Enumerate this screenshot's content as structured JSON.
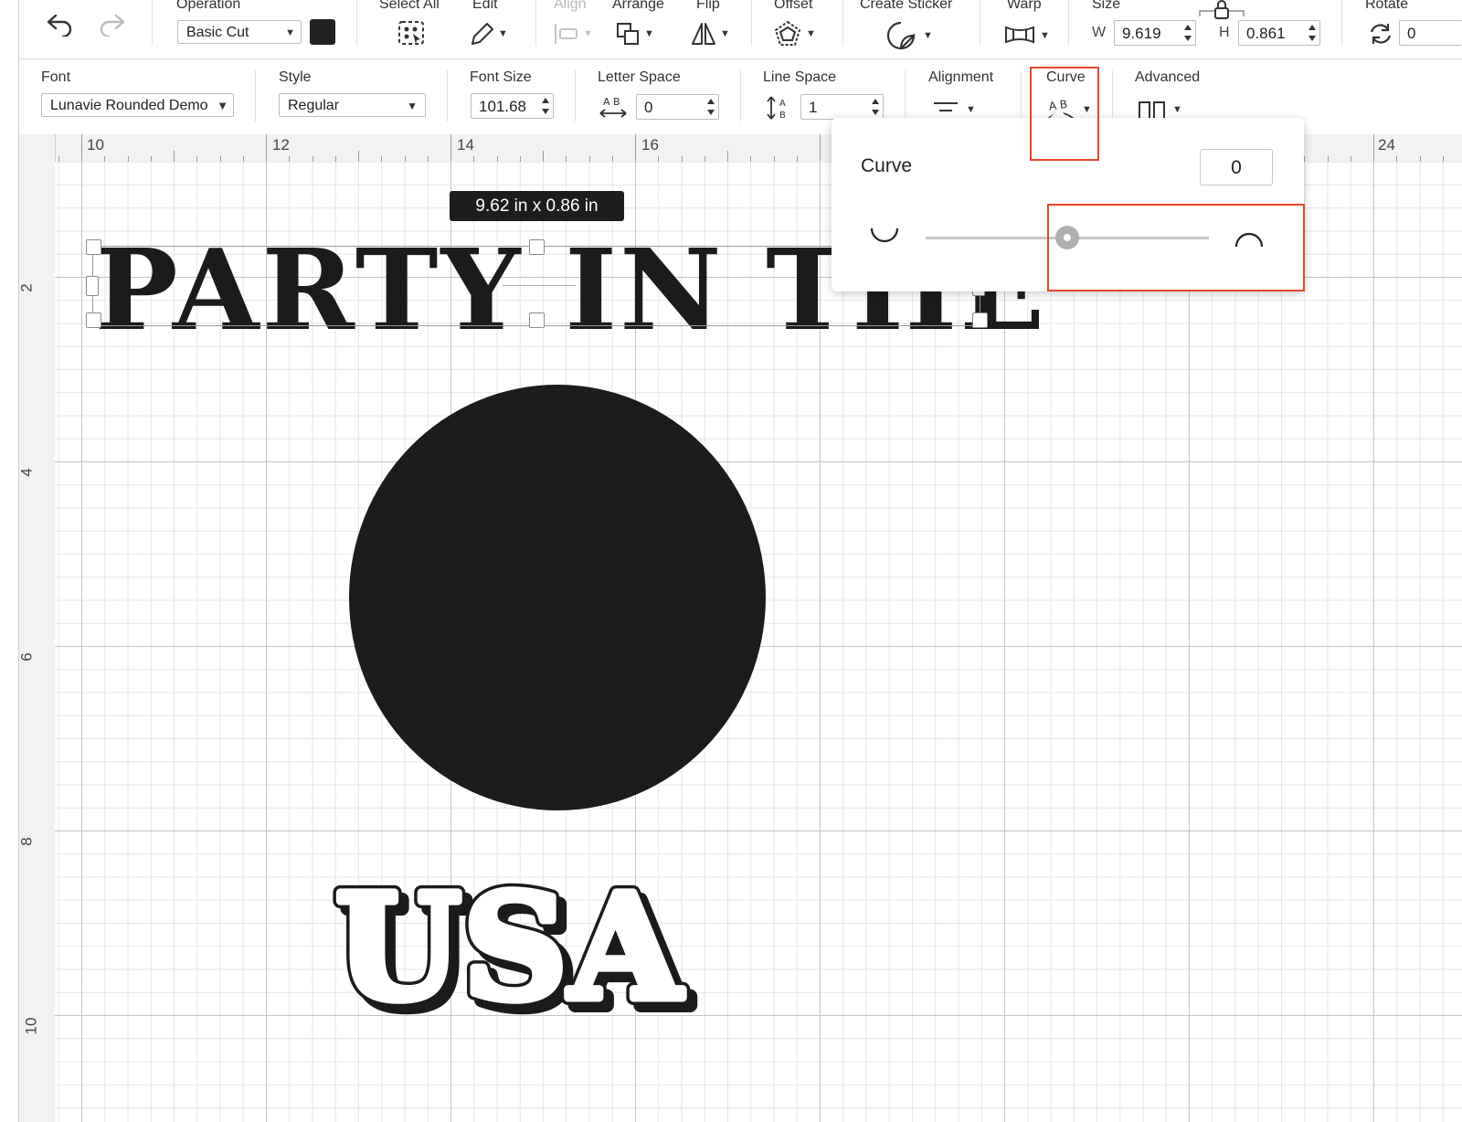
{
  "toolbar": {
    "operation_label": "Operation",
    "operation_value": "Basic Cut",
    "color_swatch": "#222222",
    "select_all_label": "Select All",
    "edit_label": "Edit",
    "align_label": "Align",
    "arrange_label": "Arrange",
    "flip_label": "Flip",
    "offset_label": "Offset",
    "create_sticker_label": "Create Sticker",
    "warp_label": "Warp",
    "size_label": "Size",
    "width_prefix": "W",
    "width_value": "9.619",
    "height_prefix": "H",
    "height_value": "0.861",
    "rotate_label": "Rotate",
    "rotate_value": "0"
  },
  "text_toolbar": {
    "font_label": "Font",
    "font_value": "Lunavie Rounded Demo",
    "style_label": "Style",
    "style_value": "Regular",
    "font_size_label": "Font Size",
    "font_size_value": "101.68",
    "letter_space_label": "Letter Space",
    "letter_space_value": "0",
    "line_space_label": "Line Space",
    "line_space_value": "1",
    "alignment_label": "Alignment",
    "curve_label": "Curve",
    "advanced_label": "Advanced"
  },
  "ruler": {
    "top": [
      "10",
      "12",
      "14",
      "16",
      "24"
    ],
    "left": [
      "2",
      "4",
      "6",
      "8",
      "10"
    ]
  },
  "canvas": {
    "size_tooltip": "9.62  in x 0.86  in",
    "selected_text": "PARTY IN THE",
    "second_text": "USA"
  },
  "curve_popover": {
    "title": "Curve",
    "value": "0",
    "slider_position": 0.5
  },
  "colors": {
    "highlight": "#e8472b",
    "shape_fill": "#1c1c1c"
  }
}
